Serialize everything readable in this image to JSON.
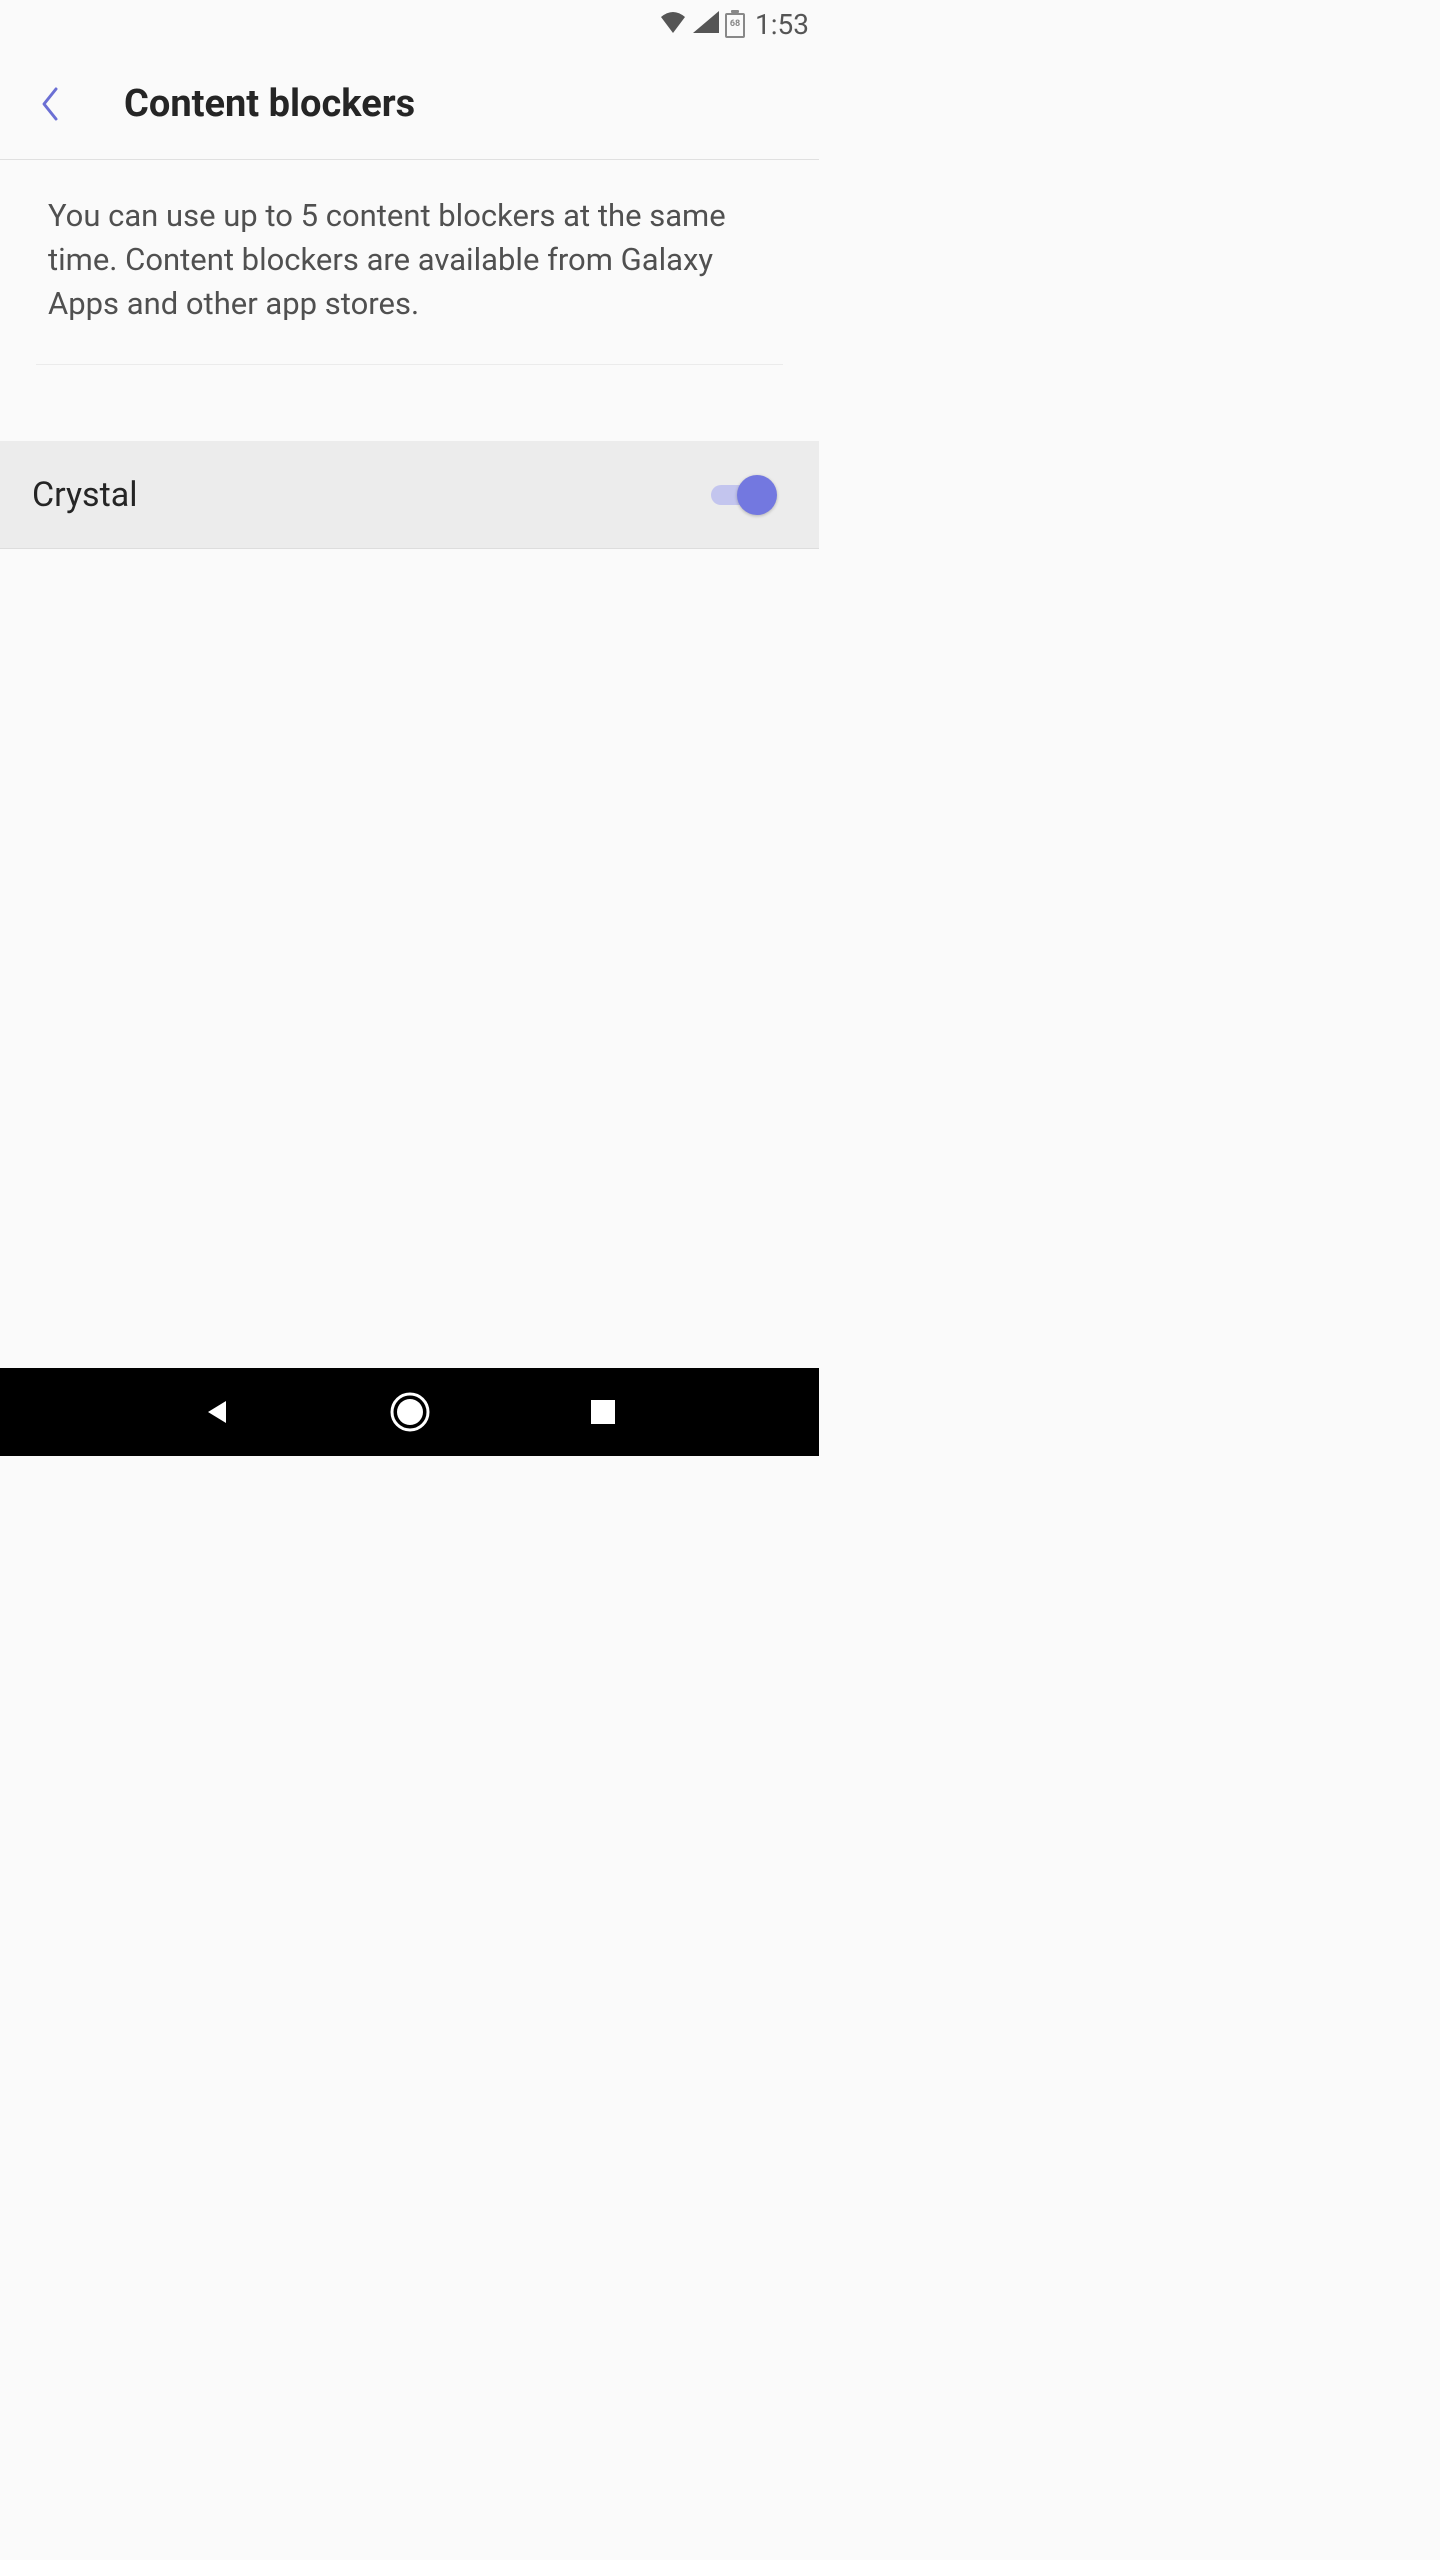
{
  "status": {
    "time": "1:53",
    "battery_level": "68"
  },
  "header": {
    "title": "Content blockers"
  },
  "description": {
    "text": "You can use up to 5 content blockers at the same time. Content blockers are available from Galaxy Apps and other app stores."
  },
  "blockers": {
    "items": [
      {
        "name": "Crystal",
        "enabled": true
      }
    ]
  },
  "colors": {
    "accent": "#7378e0",
    "accent_light": "#c3c5ee",
    "back_arrow": "#6b6fd4"
  }
}
